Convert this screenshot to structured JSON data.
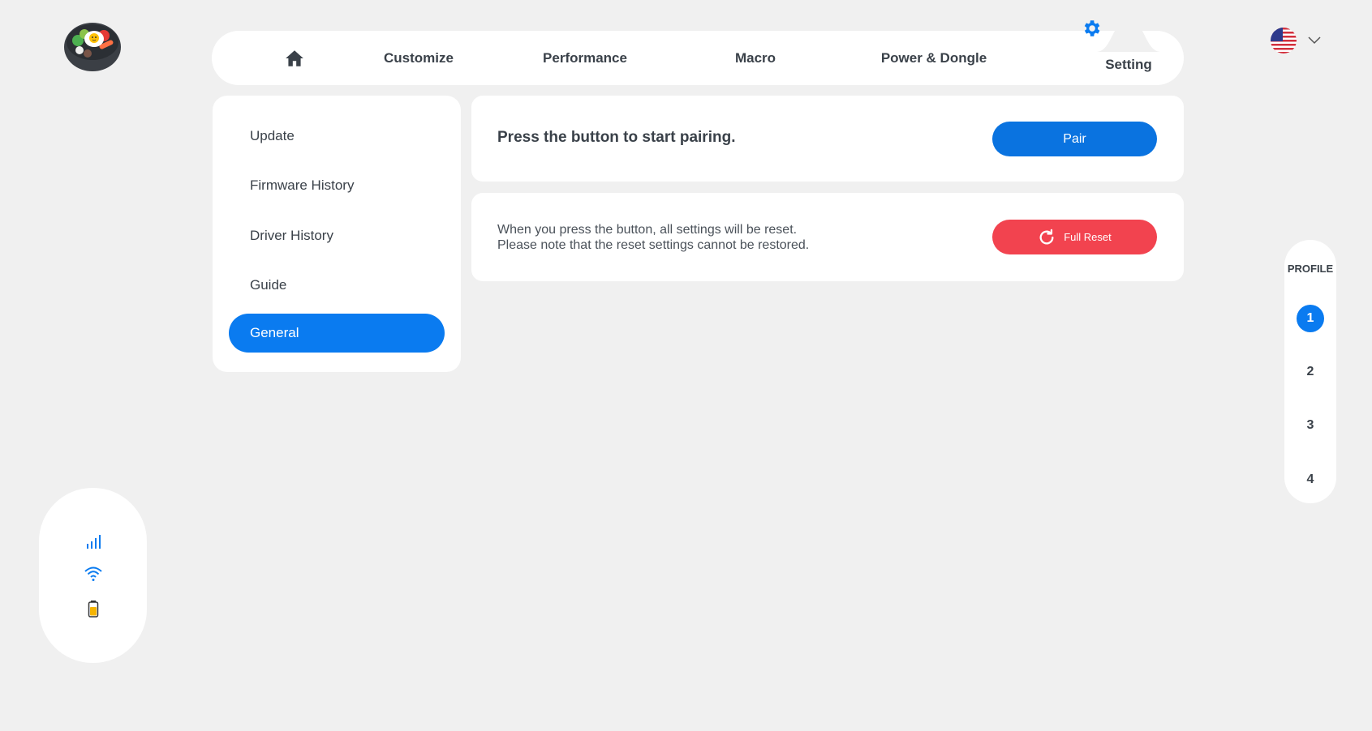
{
  "nav": {
    "home_icon": "home-icon",
    "items": [
      "Customize",
      "Performance",
      "Macro",
      "Power & Dongle",
      "Setting"
    ],
    "active": "Setting",
    "active_icon": "gear-icon"
  },
  "language": {
    "flag": "us-flag-icon",
    "dropdown_icon": "chevron-down-icon"
  },
  "sidebar": {
    "items": [
      {
        "label": "Update"
      },
      {
        "label": "Firmware History"
      },
      {
        "label": "Driver History"
      },
      {
        "label": "Guide"
      },
      {
        "label": "General"
      }
    ],
    "active": "General"
  },
  "pair_card": {
    "text": "Press the button to start pairing.",
    "button": "Pair"
  },
  "reset_card": {
    "line1": "When you press the button, all settings will be reset.",
    "line2": "Please note that the reset settings cannot be restored.",
    "button": "Full Reset",
    "button_icon": "refresh-icon"
  },
  "profile": {
    "title": "PROFILE",
    "numbers": [
      "1",
      "2",
      "3",
      "4"
    ],
    "active": "1"
  },
  "status": {
    "icons": [
      "signal-icon",
      "wifi-icon",
      "battery-icon"
    ]
  },
  "colors": {
    "accent": "#0a7bf0",
    "danger": "#f2434f",
    "background": "#f0f0f0",
    "battery": "#f5b400"
  }
}
